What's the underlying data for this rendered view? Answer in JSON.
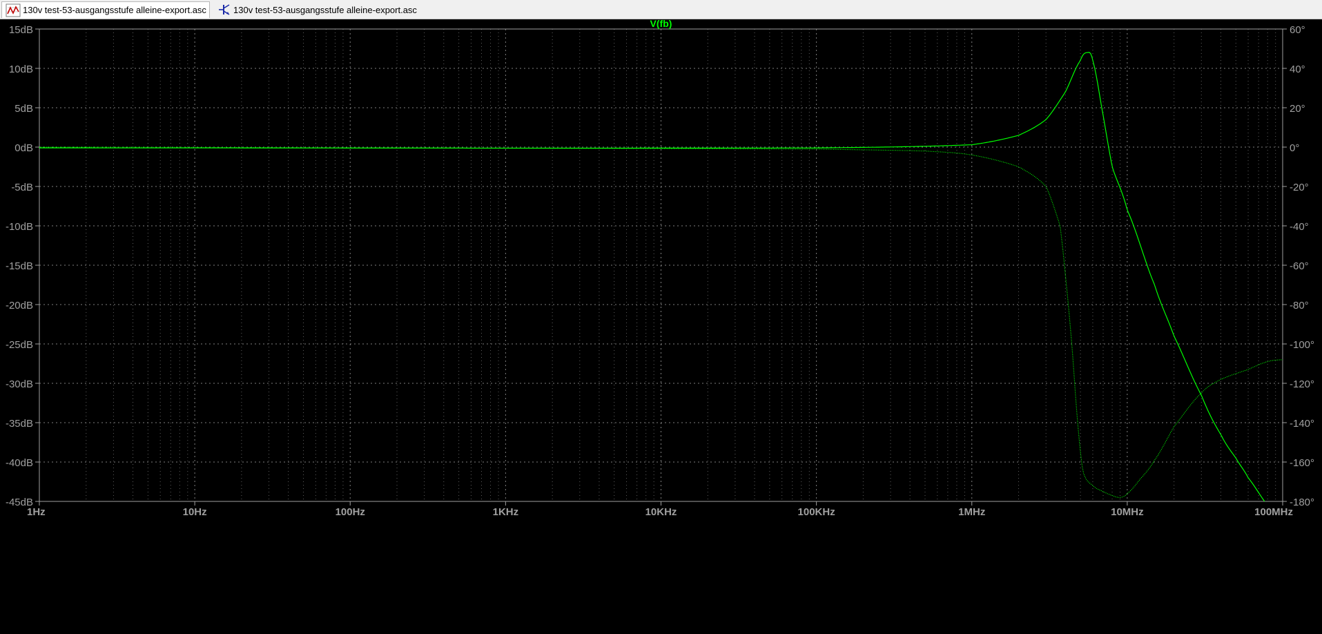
{
  "tabs": [
    {
      "label": "130v test-53-ausgangsstufe alleine-export.asc",
      "icon": "waveform-plot-icon",
      "active": true
    },
    {
      "label": "130v test-53-ausgangsstufe alleine-export.asc",
      "icon": "schematic-icon",
      "active": false
    }
  ],
  "colors": {
    "trace": "#00ff00",
    "axis": "#a0a0a0",
    "grid": "#a0a0a0",
    "background": "#000000"
  },
  "chart_data": {
    "type": "line",
    "title": "V(fb)",
    "x_scale": "log",
    "xlim": [
      1,
      100000000
    ],
    "x_ticks": [
      "1Hz",
      "10Hz",
      "100Hz",
      "1KHz",
      "10KHz",
      "100KHz",
      "1MHz",
      "10MHz",
      "100MHz"
    ],
    "ylim_left": [
      -45,
      15
    ],
    "y_ticks_left": [
      "15dB",
      "10dB",
      "5dB",
      "0dB",
      "-5dB",
      "-10dB",
      "-15dB",
      "-20dB",
      "-25dB",
      "-30dB",
      "-35dB",
      "-40dB",
      "-45dB"
    ],
    "ylim_right": [
      -180,
      60
    ],
    "y_ticks_right": [
      "60°",
      "40°",
      "20°",
      "0°",
      "-20°",
      "-40°",
      "-60°",
      "-80°",
      "-100°",
      "-120°",
      "-140°",
      "-160°",
      "-180°"
    ],
    "grid": true,
    "series": [
      {
        "name": "V(fb)",
        "quantity": "magnitude_dB",
        "style": "solid",
        "points": [
          [
            1,
            -0.1
          ],
          [
            100000,
            -0.1
          ],
          [
            1000000,
            0.3
          ],
          [
            2000000,
            1.5
          ],
          [
            3000000,
            3.5
          ],
          [
            4000000,
            7.0
          ],
          [
            5000000,
            11.0
          ],
          [
            5500000,
            12.0
          ],
          [
            6000000,
            11.0
          ],
          [
            7000000,
            4.0
          ],
          [
            8000000,
            -2.5
          ],
          [
            10000000,
            -8.0
          ],
          [
            15000000,
            -17.5
          ],
          [
            20000000,
            -24.0
          ],
          [
            30000000,
            -31.5
          ],
          [
            40000000,
            -36.5
          ],
          [
            50000000,
            -39.5
          ],
          [
            60000000,
            -42.0
          ],
          [
            80000000,
            -45.5
          ],
          [
            100000000,
            -48.0
          ]
        ]
      },
      {
        "name": "V(fb)",
        "quantity": "phase_deg",
        "style": "dotted",
        "points": [
          [
            1,
            0
          ],
          [
            100000,
            -1
          ],
          [
            500000,
            -2
          ],
          [
            1000000,
            -4
          ],
          [
            2000000,
            -10
          ],
          [
            3000000,
            -20
          ],
          [
            3700000,
            -40
          ],
          [
            4000000,
            -65
          ],
          [
            4400000,
            -100
          ],
          [
            4800000,
            -140
          ],
          [
            5200000,
            -165
          ],
          [
            6000000,
            -172
          ],
          [
            7000000,
            -175
          ],
          [
            8000000,
            -177
          ],
          [
            9000000,
            -178
          ],
          [
            10000000,
            -176
          ],
          [
            12000000,
            -169
          ],
          [
            15000000,
            -159
          ],
          [
            20000000,
            -142
          ],
          [
            30000000,
            -125
          ],
          [
            40000000,
            -118
          ],
          [
            60000000,
            -113
          ],
          [
            80000000,
            -109
          ],
          [
            100000000,
            -108
          ]
        ]
      }
    ]
  }
}
